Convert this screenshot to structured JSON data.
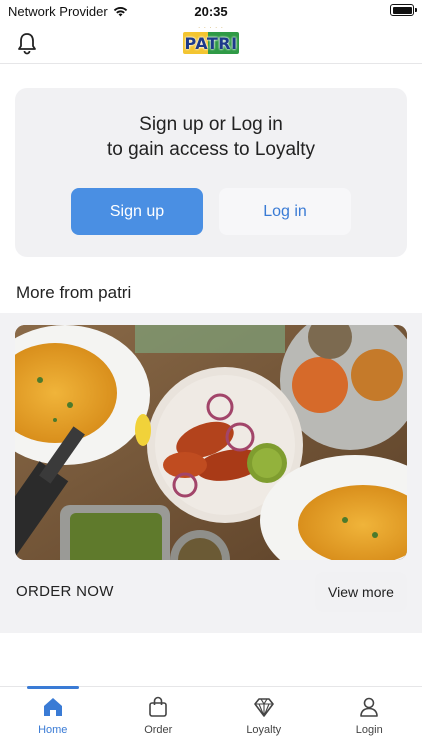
{
  "status_bar": {
    "carrier": "Network Provider",
    "time": "20:35"
  },
  "header": {
    "logo_text": "PATRI",
    "logo_subtext": "· · · · ·"
  },
  "auth_card": {
    "title_line1": "Sign up or Log in",
    "title_line2": "to gain access to Loyalty",
    "signup_label": "Sign up",
    "login_label": "Log in"
  },
  "section": {
    "title": "More from patri"
  },
  "promo": {
    "image_icon": "food-platter-image",
    "cta_text": "ORDER NOW",
    "view_more_label": "View more"
  },
  "tab_bar": {
    "items": [
      {
        "label": "Home",
        "icon": "home-icon",
        "active": true
      },
      {
        "label": "Order",
        "icon": "bag-icon",
        "active": false
      },
      {
        "label": "Loyalty",
        "icon": "diamond-icon",
        "active": false
      },
      {
        "label": "Login",
        "icon": "user-icon",
        "active": false
      }
    ]
  },
  "colors": {
    "accent": "#3a7bd5",
    "primary_button": "#4a8fe3",
    "card_bg": "#f1f1f3"
  }
}
